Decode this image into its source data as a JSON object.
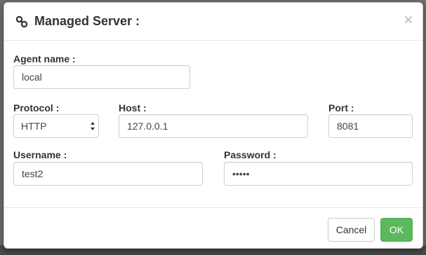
{
  "modal": {
    "title": "Managed Server :",
    "icon": "link-icon",
    "close_label": "×"
  },
  "form": {
    "agent_name": {
      "label": "Agent name :",
      "value": "local"
    },
    "protocol": {
      "label": "Protocol :",
      "value": "HTTP"
    },
    "host": {
      "label": "Host :",
      "value": "127.0.0.1"
    },
    "port": {
      "label": "Port :",
      "value": "8081"
    },
    "username": {
      "label": "Username :",
      "value": "test2"
    },
    "password": {
      "label": "Password :",
      "value": "•••••"
    }
  },
  "footer": {
    "cancel_label": "Cancel",
    "ok_label": "OK"
  },
  "colors": {
    "ok_button": "#5cb85c",
    "border": "#cfcfcf"
  }
}
